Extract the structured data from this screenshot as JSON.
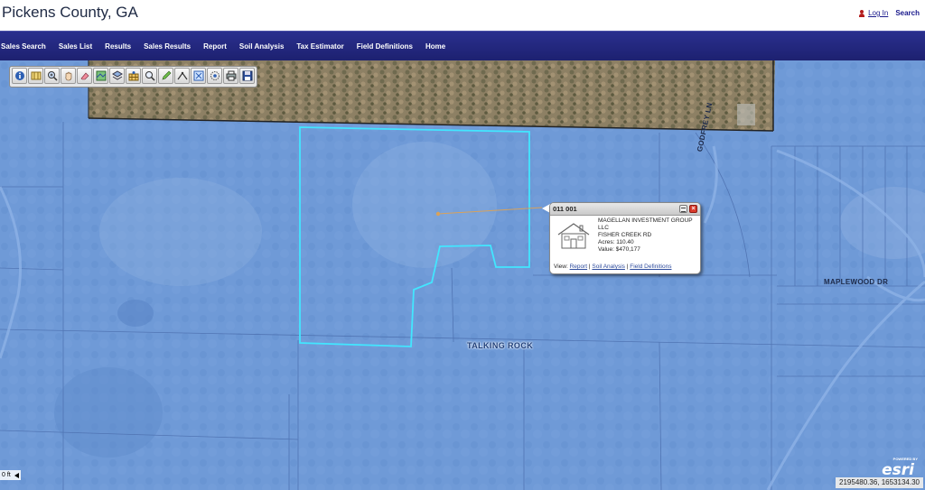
{
  "header": {
    "site_title": "Pickens County, GA",
    "login_label": "Log In",
    "search_label": "Search"
  },
  "nav": {
    "items": [
      "Sales Search",
      "Sales List",
      "Results",
      "Sales Results",
      "Report",
      "Soil Analysis",
      "Tax Estimator",
      "Field Definitions",
      "Home"
    ]
  },
  "toolbar": {
    "tools": [
      "info-icon",
      "map-icon",
      "zoom-in-icon",
      "pan-icon",
      "eraser-icon",
      "layers-icon",
      "basemap-icon",
      "parcel-grid-icon",
      "search-icon",
      "pencil-icon",
      "measure-icon",
      "full-extent-icon",
      "buffer-icon",
      "print-icon",
      "save-icon"
    ]
  },
  "map": {
    "labels": {
      "godfrey": "GODFREY LN",
      "maplewood": "MAPLEWOOD DR",
      "talking_rock": "TALKING ROCK"
    },
    "colors": {
      "parcel_highlight": "#42e6ff",
      "leader_line": "#d8a25c"
    }
  },
  "popup": {
    "title": "011 001",
    "owner_line1": "MAGELLAN INVESTMENT GROUP",
    "owner_line2": "LLC",
    "address": "FISHER CREEK RD",
    "acres": "Acres: 110.40",
    "value": "Value: $470,177",
    "view_label": "View:",
    "links": [
      "Report",
      "Soil Analysis",
      "Field Definitions"
    ],
    "separator": " | "
  },
  "footer": {
    "scale_label": "0 ft",
    "esri_small": "POWERED BY",
    "esri_logo": "esri",
    "coordinates": "2195480.36, 1653134.30"
  }
}
